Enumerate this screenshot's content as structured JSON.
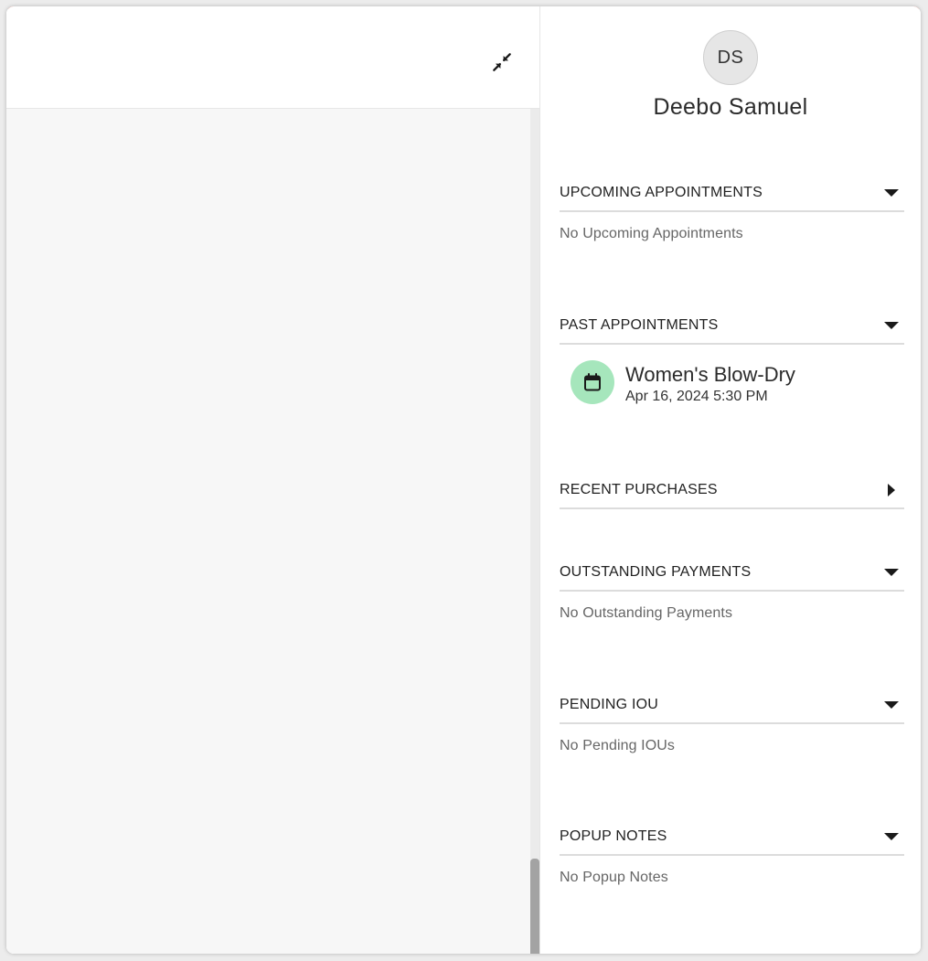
{
  "colors": {
    "accent": "#e0432a",
    "appointment_icon_bg": "#a6e6bc"
  },
  "left_pane": {
    "collapse_icon": "collapse-arrows-icon"
  },
  "client": {
    "initials": "DS",
    "name": "Deebo Samuel"
  },
  "sections": {
    "upcoming": {
      "title": "UPCOMING APPOINTMENTS",
      "expanded": true,
      "empty_text": "No Upcoming Appointments"
    },
    "past": {
      "title": "PAST APPOINTMENTS",
      "expanded": true,
      "items": [
        {
          "icon": "calendar-icon",
          "title": "Women's Blow-Dry",
          "date": "Apr 16, 2024 5:30 PM"
        }
      ]
    },
    "purchases": {
      "title": "RECENT PURCHASES",
      "expanded": false
    },
    "outstanding": {
      "title": "OUTSTANDING PAYMENTS",
      "expanded": true,
      "empty_text": "No Outstanding Payments"
    },
    "iou": {
      "title": "PENDING IOU",
      "expanded": true,
      "empty_text": "No Pending IOUs"
    },
    "notes": {
      "title": "POPUP NOTES",
      "expanded": true,
      "empty_text": "No Popup Notes"
    }
  }
}
